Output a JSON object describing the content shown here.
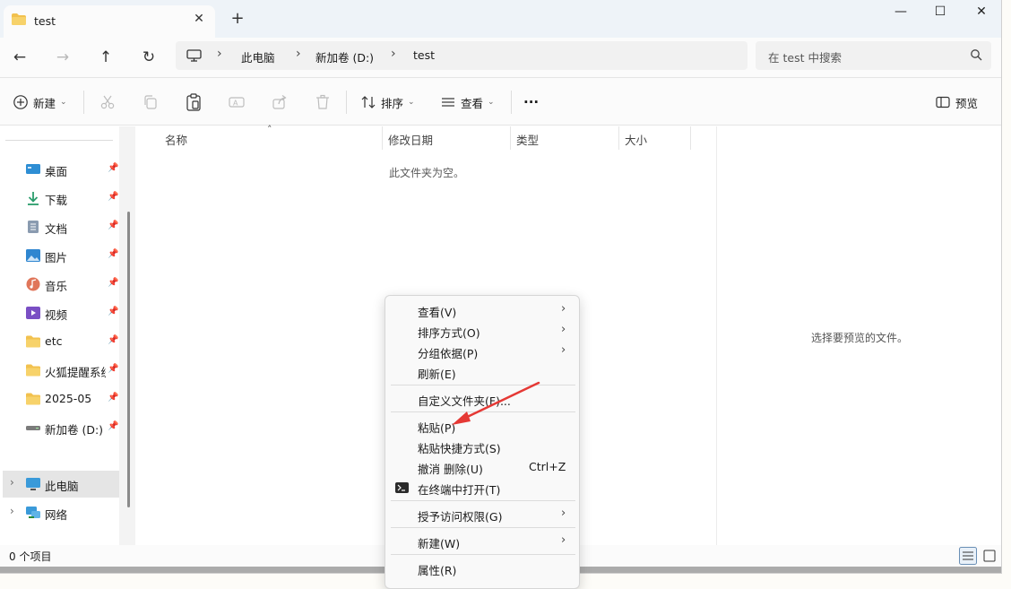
{
  "tab": {
    "title": "test",
    "close": "✕",
    "new": "+"
  },
  "window_controls": {
    "minimize": "—",
    "maximize": "☐",
    "close": "✕"
  },
  "nav": {
    "back": "←",
    "forward": "→",
    "up": "↑",
    "refresh": "↻"
  },
  "breadcrumb": [
    "此电脑",
    "新加卷 (D:)",
    "test"
  ],
  "search": {
    "placeholder": "在 test 中搜索"
  },
  "toolbar": {
    "new_label": "新建",
    "sort_label": "排序",
    "view_label": "查看",
    "more_label": "···",
    "preview_label": "预览"
  },
  "sidebar": {
    "items": [
      {
        "label": "桌面",
        "icon": "desktop-icon",
        "pinned": true
      },
      {
        "label": "下载",
        "icon": "download-icon",
        "pinned": true
      },
      {
        "label": "文档",
        "icon": "document-icon",
        "pinned": true
      },
      {
        "label": "图片",
        "icon": "picture-icon",
        "pinned": true
      },
      {
        "label": "音乐",
        "icon": "music-icon",
        "pinned": true
      },
      {
        "label": "视频",
        "icon": "video-icon",
        "pinned": true
      },
      {
        "label": "etc",
        "icon": "folder-icon",
        "pinned": true
      },
      {
        "label": "火狐提醒系统",
        "icon": "folder-icon",
        "pinned": true
      },
      {
        "label": "2025-05",
        "icon": "folder-icon",
        "pinned": true
      },
      {
        "label": "新加卷 (D:)",
        "icon": "drive-icon",
        "pinned": true
      }
    ],
    "tree": [
      {
        "label": "此电脑",
        "icon": "computer-icon",
        "selected": true
      },
      {
        "label": "网络",
        "icon": "network-icon",
        "selected": false
      }
    ]
  },
  "list": {
    "columns": [
      "名称",
      "修改日期",
      "类型",
      "大小"
    ],
    "empty_text": "此文件夹为空。"
  },
  "preview": {
    "text": "选择要预览的文件。"
  },
  "status": {
    "count": "0 个项目"
  },
  "context_menu": {
    "items": [
      {
        "label": "查看(V)",
        "submenu": true
      },
      {
        "label": "排序方式(O)",
        "submenu": true
      },
      {
        "label": "分组依据(P)",
        "submenu": true
      },
      {
        "label": "刷新(E)"
      },
      {
        "label": "自定义文件夹(F)..."
      },
      {
        "label": "粘贴(P)"
      },
      {
        "label": "粘贴快捷方式(S)"
      },
      {
        "label": "撤消 删除(U)",
        "shortcut": "Ctrl+Z"
      },
      {
        "label": "在终端中打开(T)",
        "icon": "terminal-icon"
      },
      {
        "label": "授予访问权限(G)",
        "submenu": true
      },
      {
        "label": "新建(W)",
        "submenu": true
      },
      {
        "label": "属性(R)"
      }
    ]
  },
  "colors": {
    "accent": "#0067c0",
    "annotation_arrow": "#e53935",
    "folder": "#f2c14e"
  }
}
